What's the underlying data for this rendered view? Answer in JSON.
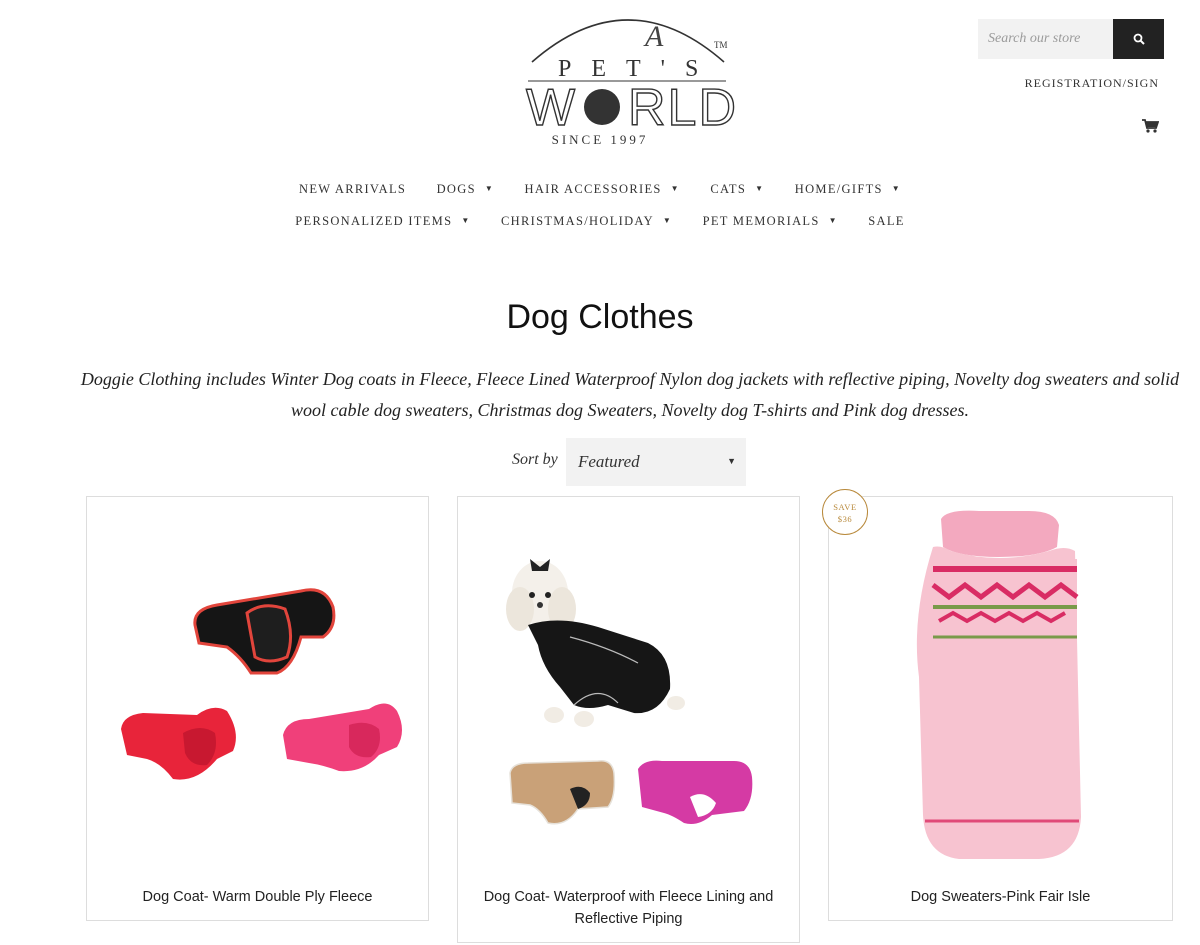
{
  "header": {
    "logo_text": "A PET'S WORLD",
    "logo_tm": "TM",
    "since": "SINCE 1997",
    "search_placeholder": "Search our store",
    "registration": "REGISTRATION/SIGN",
    "icons": {
      "search": "search-icon",
      "cart": "cart-icon"
    }
  },
  "nav": {
    "row1": [
      {
        "label": "NEW ARRIVALS",
        "dropdown": false
      },
      {
        "label": "DOGS",
        "dropdown": true
      },
      {
        "label": "HAIR ACCESSORIES",
        "dropdown": true
      },
      {
        "label": "CATS",
        "dropdown": true
      },
      {
        "label": "HOME/GIFTS",
        "dropdown": true
      }
    ],
    "row2": [
      {
        "label": "PERSONALIZED ITEMS",
        "dropdown": true
      },
      {
        "label": "CHRISTMAS/HOLIDAY",
        "dropdown": true
      },
      {
        "label": "PET MEMORIALS",
        "dropdown": true
      },
      {
        "label": "SALE",
        "dropdown": false
      }
    ],
    "caret": "▼"
  },
  "collection": {
    "title": "Dog Clothes",
    "description": "Doggie Clothing includes Winter Dog coats in Fleece, Fleece Lined Waterproof Nylon dog jackets with reflective piping, Novelty dog sweaters and solid wool cable dog sweaters, Christmas dog Sweaters, Novelty dog T-shirts and Pink dog dresses."
  },
  "sort": {
    "label": "Sort by",
    "selected": "Featured"
  },
  "products": [
    {
      "name": "Dog Coat- Warm Double Ply Fleece"
    },
    {
      "name": "Dog Coat- Waterproof with Fleece Lining and Reflective Piping"
    },
    {
      "name": "Dog Sweaters-Pink Fair Isle",
      "badge_line1": "SAVE",
      "badge_line2": "$36"
    }
  ],
  "colors": {
    "accent_gold": "#b8893b",
    "search_button": "#222222",
    "field_bg": "#f2f2f2"
  }
}
